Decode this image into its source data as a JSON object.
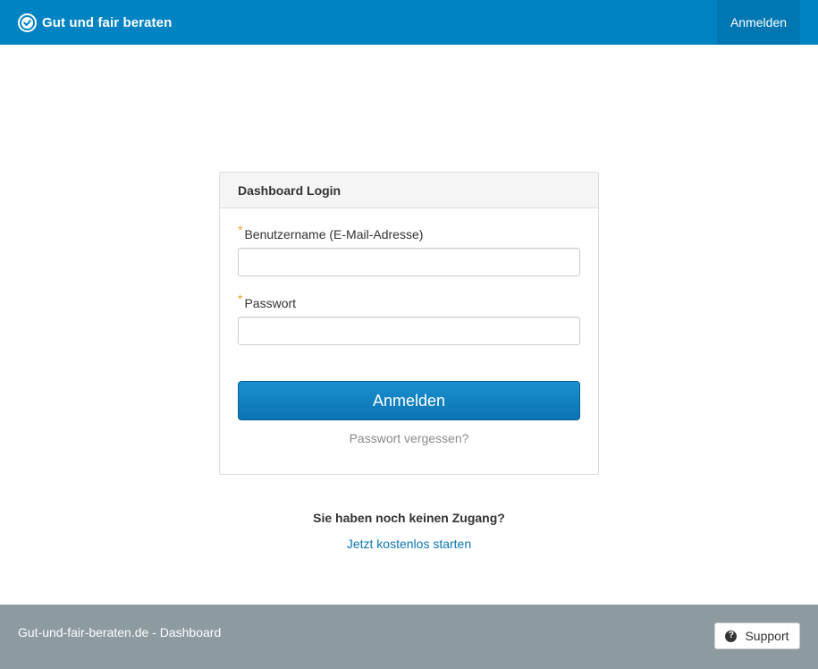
{
  "header": {
    "brand": "Gut und fair beraten",
    "brand_icon": "check-circle-icon",
    "login_label": "Anmelden",
    "color": "#0083c3"
  },
  "login_panel": {
    "title": "Dashboard Login",
    "username_label": "Benutzername (E-Mail-Adresse)",
    "username_value": "",
    "password_label": "Passwort",
    "password_value": "",
    "required_marker": "*",
    "submit_label": "Anmelden",
    "forgot_label": "Passwort vergessen?"
  },
  "signup": {
    "question": "Sie haben noch keinen Zugang?",
    "link": "Jetzt kostenlos starten"
  },
  "footer": {
    "text": "Gut-und-fair-beraten.de - Dashboard",
    "support_label": "Support",
    "support_icon": "question-circle-icon",
    "color": "#8d9aa0"
  }
}
